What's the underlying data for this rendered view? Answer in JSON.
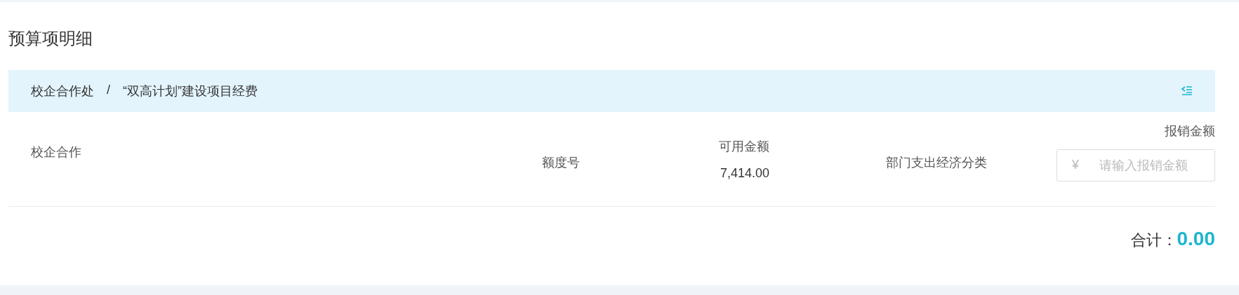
{
  "section_title": "预算项明细",
  "breadcrumb": {
    "items": [
      "校企合作处",
      "“双高计划”建设项目经费"
    ],
    "separator": "/"
  },
  "row": {
    "name": "校企合作",
    "quota_label": "额度号",
    "available_label": "可用金额",
    "available_value": "7,414.00",
    "category_label": "部门支出经济分类",
    "amount_label": "报销金额",
    "amount_prefix": "¥",
    "amount_placeholder": "请输入报销金额"
  },
  "total": {
    "label": "合计：",
    "value": "0.00"
  }
}
